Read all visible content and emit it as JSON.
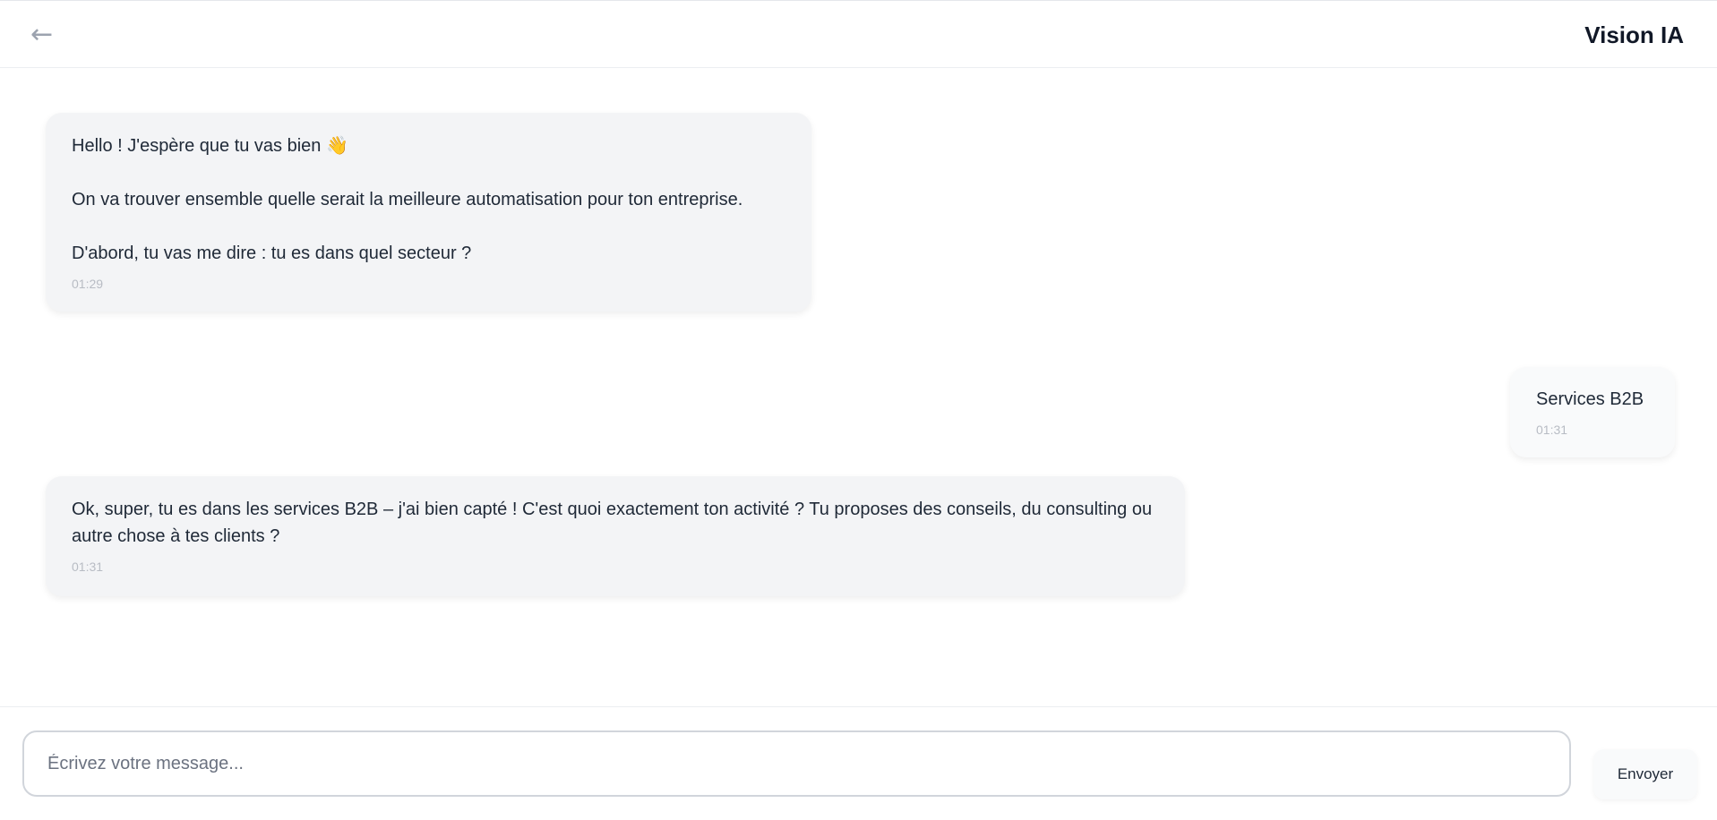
{
  "header": {
    "back_icon": "←",
    "title": "Vision IA"
  },
  "messages": [
    {
      "role": "bot",
      "lines": [
        "Hello ! J'espère que tu vas bien 👋",
        "On va trouver ensemble quelle serait la meilleure automatisation pour ton entreprise.",
        "D'abord, tu vas me dire : tu es dans quel secteur ?"
      ],
      "time": "01:29"
    },
    {
      "role": "user",
      "lines": [
        "Services B2B"
      ],
      "time": "01:31"
    },
    {
      "role": "bot",
      "lines": [
        "Ok, super, tu es dans les services B2B – j'ai bien capté ! C'est quoi exactement ton activité ? Tu proposes des conseils, du consulting ou autre chose à tes clients ?"
      ],
      "time": "01:31"
    }
  ],
  "composer": {
    "placeholder": "Écrivez votre message...",
    "value": "",
    "send_label": "Envoyer"
  },
  "colors": {
    "bot_bubble": "#f3f4f6",
    "user_bubble": "#f9fafb",
    "text": "#1f2937",
    "timestamp": "#b8bcc4"
  }
}
